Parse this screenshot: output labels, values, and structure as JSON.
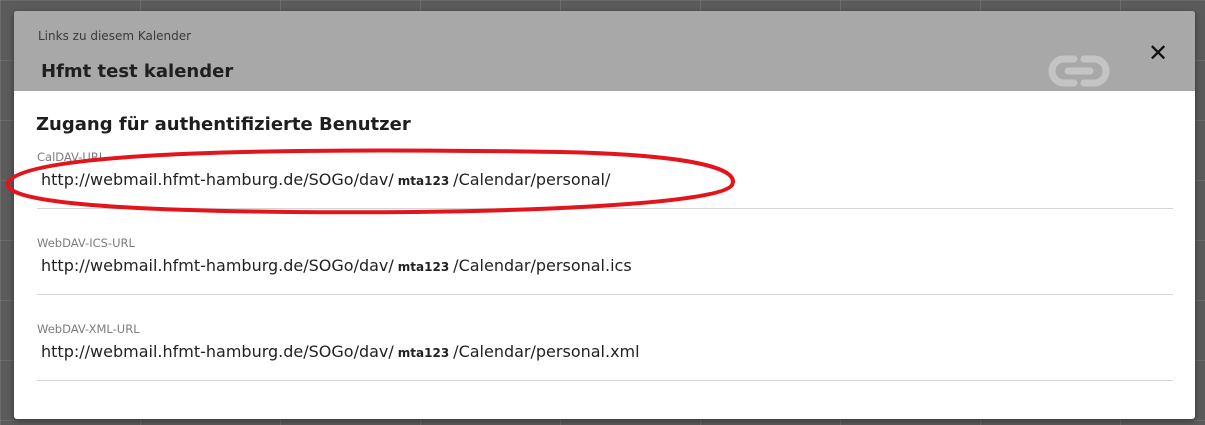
{
  "header": {
    "subtitle": "Links zu diesem Kalender",
    "title": "Hfmt test kalender",
    "close_label": "✕",
    "link_icon": "link-icon",
    "close_icon": "close-icon"
  },
  "section": {
    "heading": "Zugang für authentifizierte Benutzer"
  },
  "links": [
    {
      "label": "CalDAV-URL",
      "prefix": "http://webmail.hfmt-hamburg.de/SOGo/dav/",
      "user": "mta123",
      "suffix": "/Calendar/personal/"
    },
    {
      "label": "WebDAV-ICS-URL",
      "prefix": "http://webmail.hfmt-hamburg.de/SOGo/dav/",
      "user": "mta123",
      "suffix": "/Calendar/personal.ics"
    },
    {
      "label": "WebDAV-XML-URL",
      "prefix": "http://webmail.hfmt-hamburg.de/SOGo/dav/",
      "user": "mta123",
      "suffix": "/Calendar/personal.xml"
    }
  ],
  "colors": {
    "header_bg": "#a8a8a8",
    "annotation": "#e3141b"
  }
}
